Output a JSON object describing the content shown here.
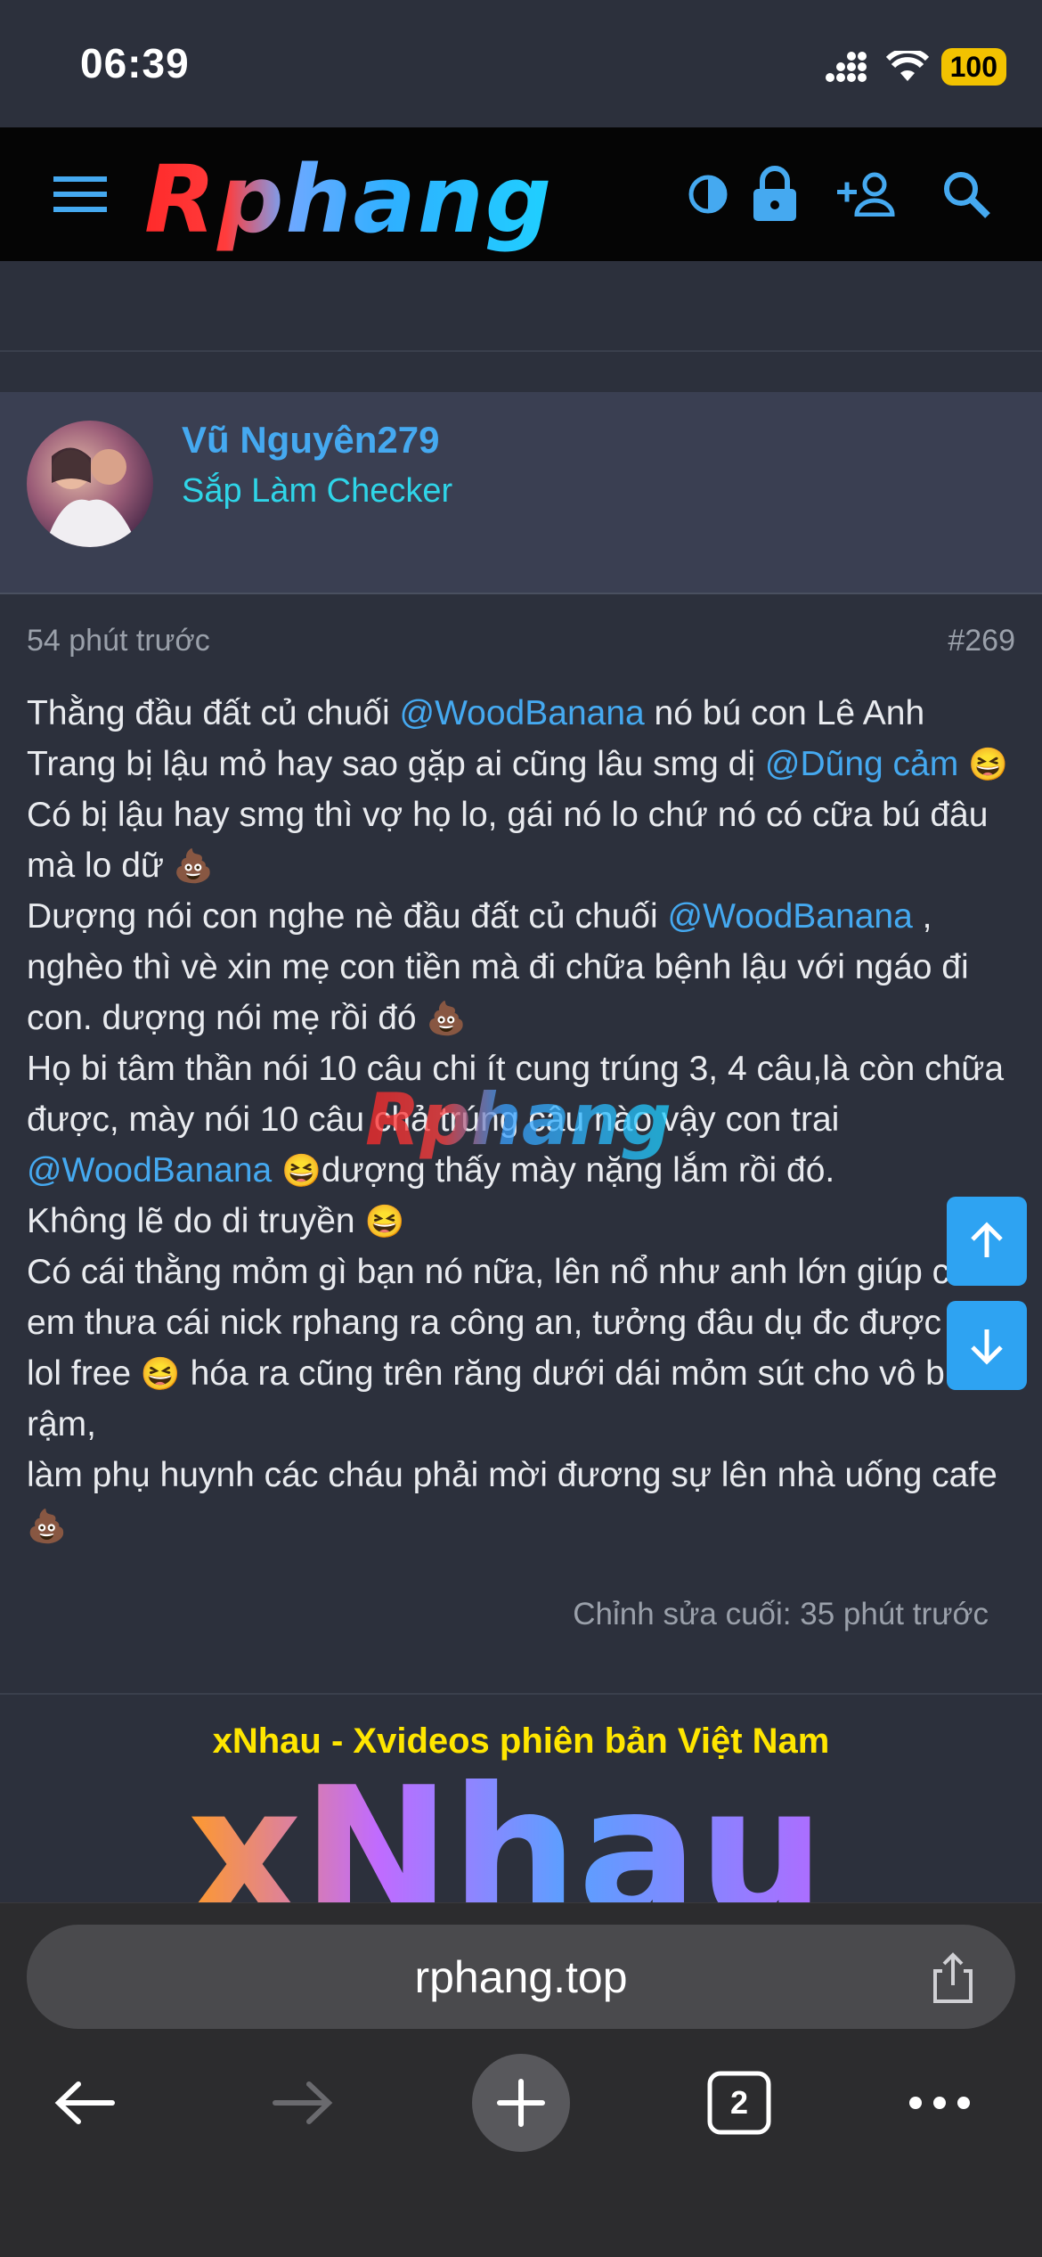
{
  "status": {
    "time": "06:39",
    "battery": "100"
  },
  "header": {
    "logo": "Rphang"
  },
  "post": {
    "username": "Vũ Nguyên279",
    "user_title": "Sắp Làm Checker",
    "time": "54 phút trước",
    "number": "#269",
    "edited": "Chỉnh sửa cuối: 35 phút trước",
    "content": {
      "p1a": "Thằng đầu đất củ chuối ",
      "m1": "@WoodBanana",
      "p1b": " nó bú con Lê Anh Trang bị lậu mỏ hay sao gặp ai cũng lâu smg dị ",
      "m2": "@Dũng cảm",
      "p1c": " Có bị lậu hay smg thì vợ họ lo, gái nó lo chứ nó có cữa bú đâu mà lo dữ",
      "p2a": "Dượng nói con nghe nè đầu đất củ chuối ",
      "m3": "@WoodBanana",
      "p2b": " , nghèo thì vè xin mẹ con tiền mà đi chữa bệnh lậu với ngáo đi con. dượng nói mẹ rồi đó",
      "p3a": "Họ bi tâm thần nói 10 câu chi ít cung trúng 3, 4 câu,là còn chữa được, mày nói 10 câu chả trúng câu nào vậy con trai ",
      "m4": "@WoodBanana",
      "p3b": "dượng thấy mày nặng lắm rồi đó.",
      "p4": "Không lẽ do di truyền",
      "p5a": "Có cái thằng mỏm gì bạn nó nữa, lên nổ như anh lớn giúp các em thưa cái nick rphang ra công an, tưởng đâu dụ đc được bú lol free",
      "p5b": " hóa ra cũng trên răng dưới dái mỏm sút cho vô bui rậm,",
      "p6": "làm phụ huynh các cháu phải mời đương sự lên nhà uống cafe"
    },
    "watermark": "Rphang"
  },
  "ad": {
    "title": "xNhau - Xvideos phiên bản Việt Nam",
    "logo": "xNhau"
  },
  "browser": {
    "url": "rphang.top",
    "tab_count": "2"
  }
}
